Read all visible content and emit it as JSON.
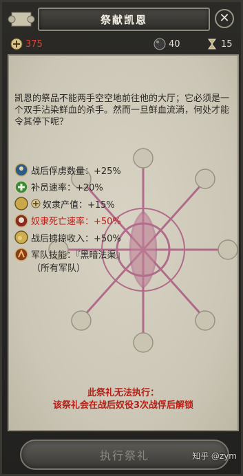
{
  "window": {
    "title": "祭献凯恩"
  },
  "resources": {
    "left_value": "375",
    "mid_value": "40",
    "right_value": "15"
  },
  "description": "凯恩的祭品不能两手空空地前往他的大厅；它必须是一个双手沾染鲜血的杀手。然而一旦鲜血流淌，何处才能令其停下呢？",
  "effects": [
    {
      "text": "战后俘虏数量：+25%"
    },
    {
      "text": "补员速率：+20%"
    },
    {
      "text": "奴隶产值：+15%"
    },
    {
      "text": "奴隶死亡速率：+50%"
    },
    {
      "text": "战后掳掠收入：+50%"
    },
    {
      "text": "军队技能：『黑暗法渠』"
    },
    {
      "text": "（所有军队）"
    }
  ],
  "warning": {
    "line1": "此祭礼无法执行：",
    "line2": "该祭礼会在战后奴役3次战俘后解锁"
  },
  "button": {
    "label": "执行祭礼"
  },
  "watermark": "知乎 @zym",
  "colors": {
    "negative": "#b8201a",
    "warning": "#b51f17",
    "emblem": "#9a2a6a"
  }
}
